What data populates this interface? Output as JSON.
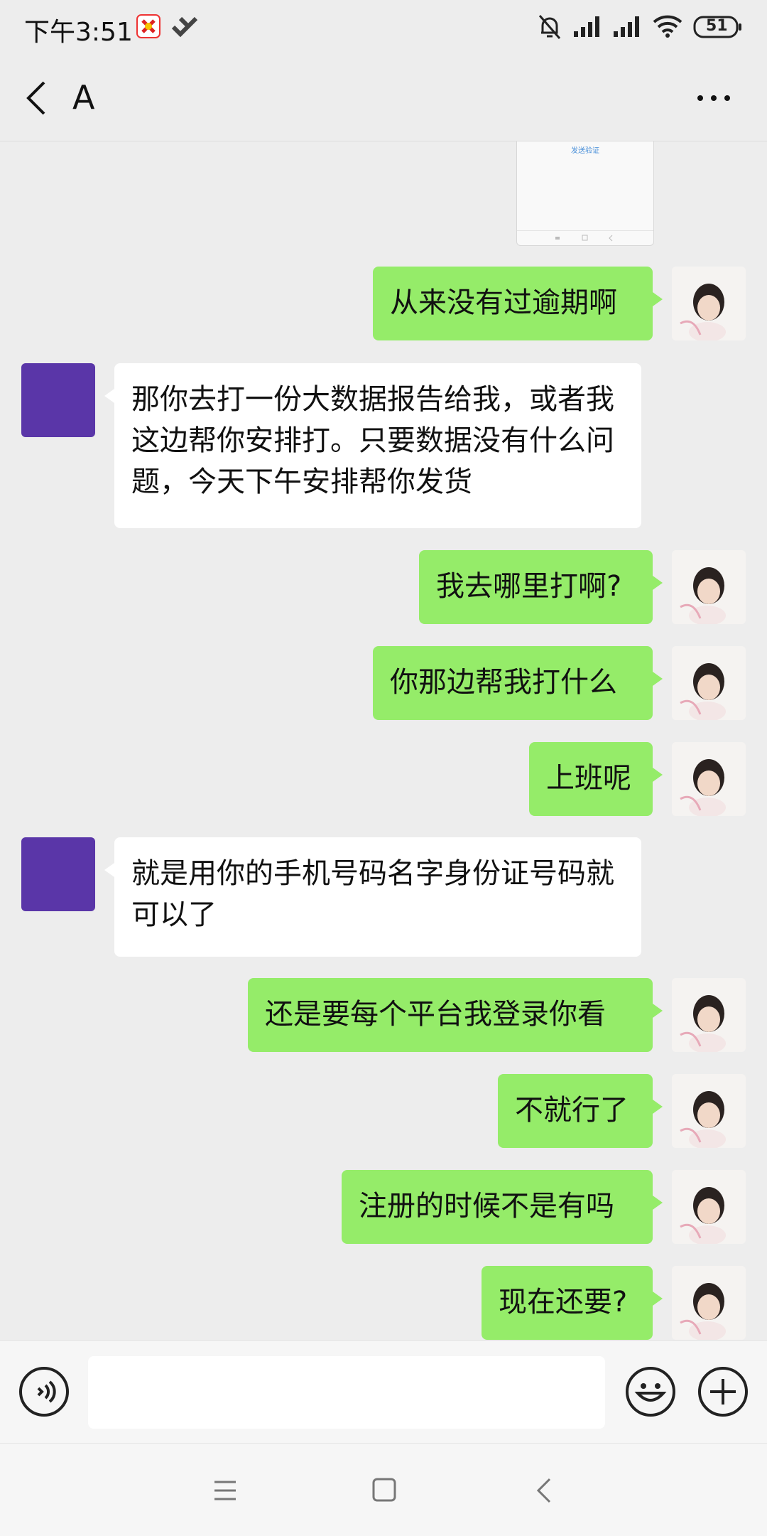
{
  "status_bar": {
    "time": "下午3:51",
    "battery": "51",
    "icons": [
      "app-notification-icon",
      "vpn-icon",
      "mute-icon",
      "signal-icon",
      "signal-icon",
      "wifi-icon",
      "battery-icon"
    ]
  },
  "header": {
    "title": "A",
    "back_icon": "back-arrow-icon",
    "more_icon": "more-options-icon"
  },
  "screenshot_preview": {
    "caption": "发送验证"
  },
  "messages": [
    {
      "sender": "me",
      "text": "从来没有过逾期啊"
    },
    {
      "sender": "other",
      "text": "那你去打一份大数据报告给我，或者我这边帮你安排打。只要数据没有什么问题，今天下午安排帮你发货"
    },
    {
      "sender": "me",
      "text": "我去哪里打啊?"
    },
    {
      "sender": "me",
      "text": "你那边帮我打什么"
    },
    {
      "sender": "me",
      "text": "上班呢"
    },
    {
      "sender": "other",
      "text": "就是用你的手机号码名字身份证号码就可以了"
    },
    {
      "sender": "me",
      "text": "还是要每个平台我登录你看"
    },
    {
      "sender": "me",
      "text": "不就行了"
    },
    {
      "sender": "me",
      "text": "注册的时候不是有吗"
    },
    {
      "sender": "me",
      "text": "现在还要?"
    }
  ],
  "input_bar": {
    "voice_icon": "voice-input-icon",
    "input_value": "",
    "emoji_icon": "emoji-icon",
    "add_icon": "add-icon"
  },
  "nav_bar": {
    "icons": [
      "menu-icon",
      "home-icon",
      "back-icon"
    ]
  },
  "colors": {
    "background": "#ededed",
    "my_bubble": "#95ec69",
    "other_bubble": "#ffffff",
    "other_avatar": "#5a36a8"
  }
}
